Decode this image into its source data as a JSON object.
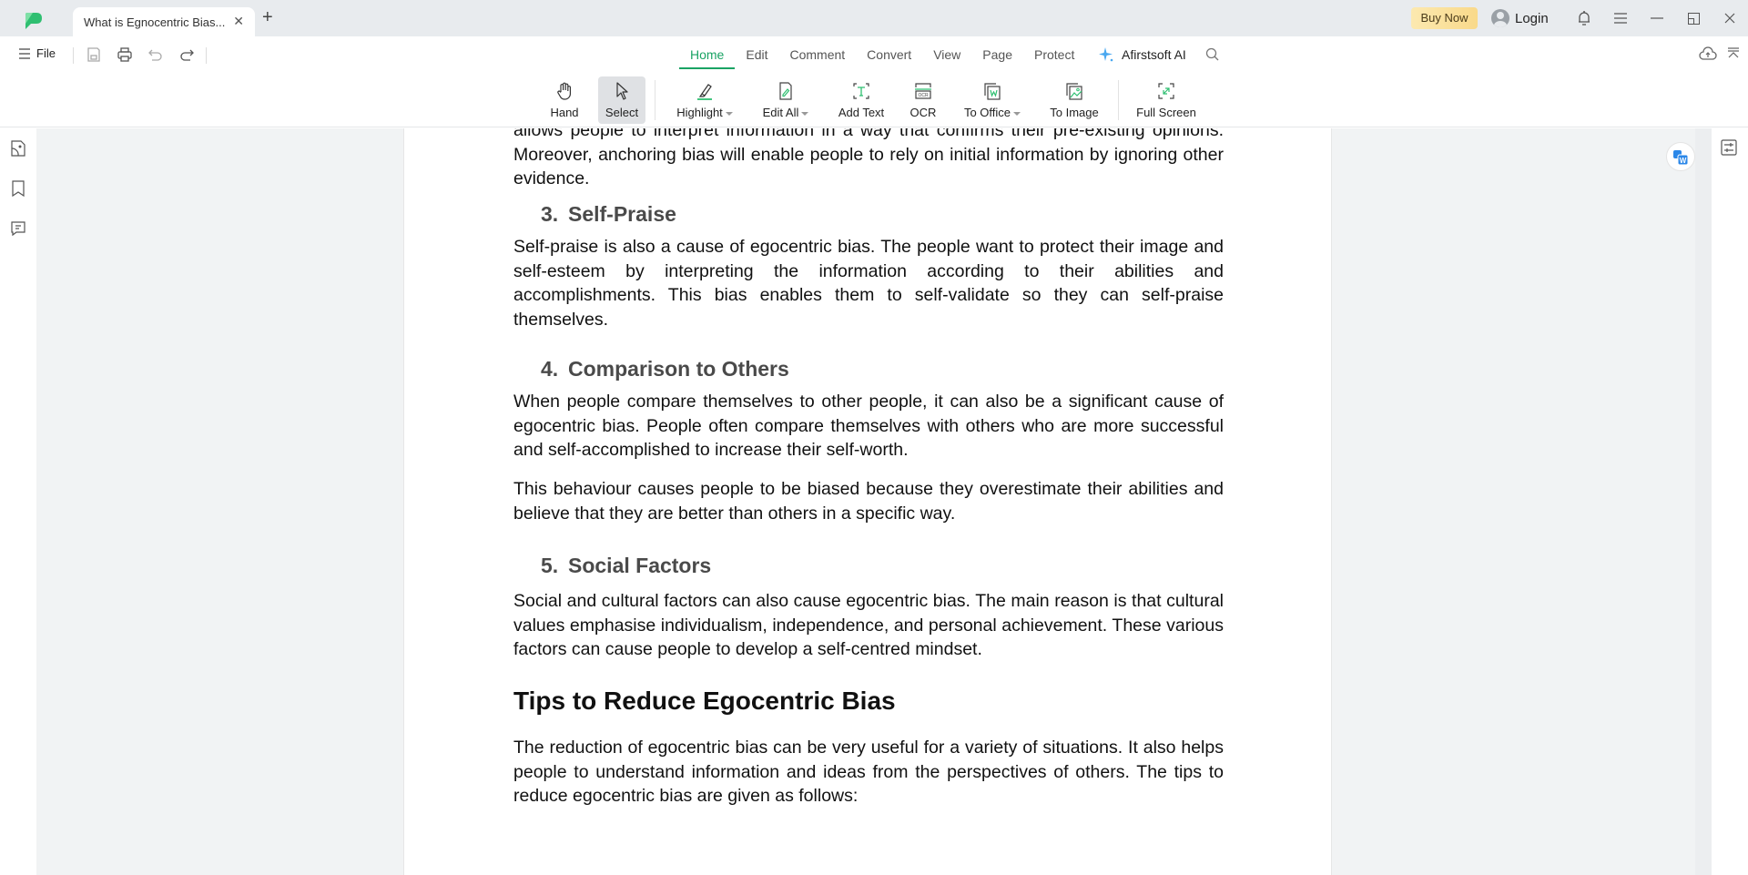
{
  "app": {
    "tab_title": "What is Egnocentric Bias...",
    "buy_now": "Buy Now",
    "login": "Login"
  },
  "menu": {
    "file": "File",
    "tabs": [
      "Home",
      "Edit",
      "Comment",
      "Convert",
      "View",
      "Page",
      "Protect"
    ],
    "active_tab": "Home",
    "ai_label": "Afirstsoft AI"
  },
  "toolbar": {
    "hand": "Hand",
    "select": "Select",
    "highlight": "Highlight",
    "edit_all": "Edit All",
    "add_text": "Add Text",
    "ocr": "OCR",
    "to_office": "To Office",
    "to_image": "To Image",
    "full_screen": "Full Screen"
  },
  "document": {
    "partial_top": "allows people to interpret information in a way that confirms their pre-existing opinions. Moreover, anchoring bias will enable people to rely on initial information by ignoring other evidence.",
    "sections": [
      {
        "num": "3.",
        "title": "Self-Praise",
        "paragraphs": [
          "Self-praise is also a cause of egocentric bias. The people want to protect their image and self-esteem by interpreting the information according to their abilities and accomplishments. This bias enables them to self-validate so they can self-praise themselves."
        ]
      },
      {
        "num": "4.",
        "title": "Comparison to Others",
        "paragraphs": [
          "When people compare themselves to other people, it can also be a significant cause of egocentric bias. People often compare themselves with others who are more successful and self-accomplished to increase their self-worth.",
          "This behaviour causes people to be biased because they overestimate their abilities and believe that they are better than others in a specific way."
        ]
      },
      {
        "num": "5.",
        "title": "Social Factors",
        "paragraphs": [
          "Social and cultural factors can also cause egocentric bias. The main reason is that cultural values emphasise individualism, independence, and personal achievement. These various factors can cause people to develop a self-centred mindset."
        ]
      }
    ],
    "h2": "Tips to Reduce Egocentric Bias",
    "h2_paragraph": "The reduction of egocentric bias can be very useful for a variety of situations. It also helps people to understand information and ideas from the perspectives of others. The tips to reduce egocentric bias are given as follows:"
  },
  "colors": {
    "accent": "#1aa364",
    "buy_now_bg": "#f9d98a",
    "translate_blue": "#2b87e8"
  }
}
